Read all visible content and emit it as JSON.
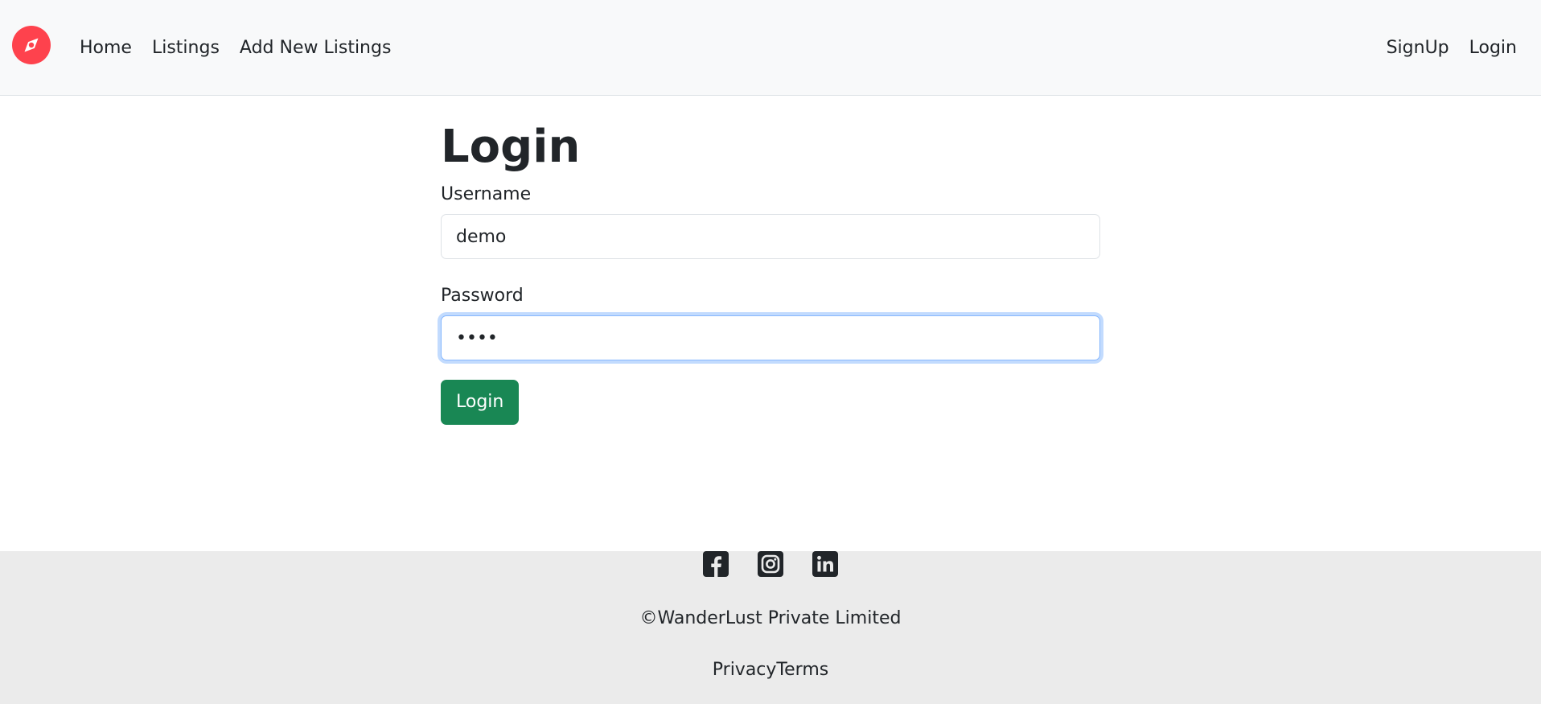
{
  "navbar": {
    "brand_icon": "compass-icon",
    "brand_color": "#fe424d",
    "left_links": [
      "Home",
      "Listings",
      "Add New Listings"
    ],
    "right_links": [
      "SignUp",
      "Login"
    ]
  },
  "form": {
    "title": "Login",
    "username_label": "Username",
    "username_value": "demo",
    "password_label": "Password",
    "password_value": "demo",
    "submit_label": "Login",
    "submit_color": "#198754"
  },
  "footer": {
    "social_icons": [
      "facebook-icon",
      "instagram-icon",
      "linkedin-icon"
    ],
    "copyright": "©WanderLust Private Limited",
    "links": [
      "Privacy",
      "Terms"
    ]
  }
}
